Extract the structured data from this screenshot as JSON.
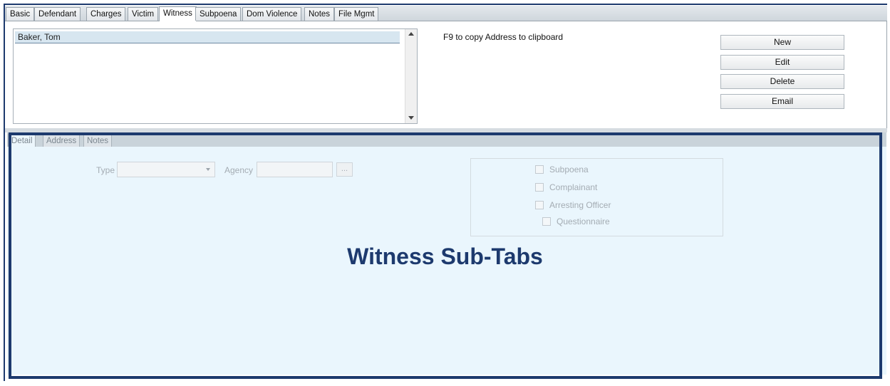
{
  "main_tabs": [
    {
      "label": "Basic",
      "active": false
    },
    {
      "label": "Defendant",
      "active": false
    },
    {
      "label": "Charges",
      "active": false
    },
    {
      "label": "Victim",
      "active": false
    },
    {
      "label": "Witness",
      "active": true
    },
    {
      "label": "Subpoena",
      "active": false
    },
    {
      "label": "Dom Violence",
      "active": false
    },
    {
      "label": "Notes",
      "active": false
    },
    {
      "label": "File Mgmt",
      "active": false
    }
  ],
  "witness_list": {
    "items": [
      "Baker, Tom"
    ],
    "selected_index": 0
  },
  "hint_text": "F9 to copy Address to clipboard",
  "actions": {
    "new_label": "New",
    "edit_label": "Edit",
    "delete_label": "Delete",
    "email_label": "Email"
  },
  "sub_tabs": [
    {
      "label": "Detail",
      "active": true
    },
    {
      "label": "Address",
      "active": false
    },
    {
      "label": "Notes",
      "active": false
    }
  ],
  "detail": {
    "type_label": "Type",
    "type_value": "",
    "agency_label": "Agency",
    "agency_value": "",
    "ellipsis_label": "...",
    "checkboxes": {
      "subpoena": {
        "label": "Subpoena",
        "checked": false
      },
      "complainant": {
        "label": "Complainant",
        "checked": false
      },
      "arresting_officer": {
        "label": "Arresting Officer",
        "checked": false
      },
      "questionnaire": {
        "label": "Questionnaire",
        "checked": false
      }
    }
  },
  "annotation": {
    "title": "Witness Sub-Tabs",
    "color": "#1d3a6e"
  }
}
